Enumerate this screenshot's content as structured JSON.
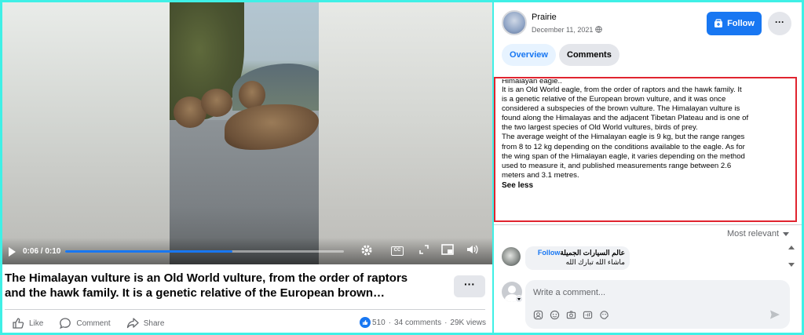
{
  "video": {
    "time_display": "0:06 / 0:10",
    "progress_fraction": 0.6
  },
  "post": {
    "title_line1": "The Himalayan vulture is an Old World vulture, from the order of raptors",
    "title_line2": "and the hawk family. It is a genetic relative of the European brown…",
    "more_label": "···",
    "actions": {
      "like": "Like",
      "comment": "Comment",
      "share": "Share"
    },
    "stats": {
      "reactions": "510",
      "separator": "·",
      "comments": "34 comments",
      "views": "29K views"
    }
  },
  "sidebar": {
    "author": "Prairie",
    "date": "December 11, 2021",
    "follow_label": "Follow",
    "menu_label": "···",
    "tabs": [
      {
        "label": "Overview"
      },
      {
        "label": "Comments"
      }
    ],
    "description_lines": [
      "Himalayan eagle..",
      "It is an Old World eagle, from the order of raptors and the hawk family. It",
      "is a genetic relative of the European brown vulture, and it was once",
      "considered a subspecies of the brown vulture. The Himalayan vulture is",
      "found along the Himalayas and the adjacent Tibetan Plateau and is one of",
      "the two largest species of Old World vultures, birds of prey.",
      "The average weight of the Himalayan eagle is 9 kg, but the range ranges",
      "from 8 to 12 kg depending on the conditions available to the eagle. As for",
      "the wing span of the Himalayan eagle, it varies depending on the method",
      "used to measure it, and published measurements range between 2.6",
      "meters and 3.1 metres."
    ],
    "see_less": "See less",
    "sort_label": "Most relevant",
    "comment": {
      "author": "عالم السيارات الجميلة",
      "follow": "Follow",
      "text": "ماشاء الله تبارك الله"
    },
    "comment_box": {
      "placeholder": "Write a comment..."
    }
  },
  "colors": {
    "accent": "#1877f2",
    "highlight_border": "#e0242f",
    "frame_background": "#3ff0e6"
  }
}
